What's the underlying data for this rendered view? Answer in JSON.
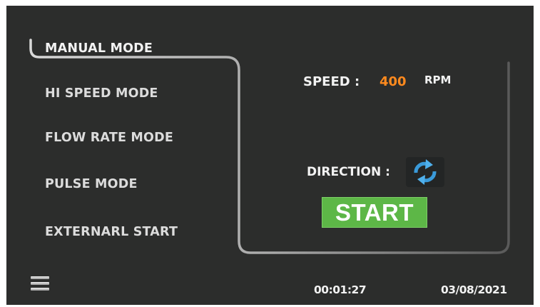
{
  "modes": [
    {
      "label": "MANUAL MODE",
      "active": true
    },
    {
      "label": "HI SPEED MODE",
      "active": false
    },
    {
      "label": "FLOW RATE MODE",
      "active": false
    },
    {
      "label": "PULSE MODE",
      "active": false
    },
    {
      "label": "EXTERNARL START",
      "active": false
    }
  ],
  "panel": {
    "speed_label": "SPEED :",
    "speed_value": "400",
    "speed_unit": "RPM",
    "direction_label": "DIRECTION :",
    "direction_icon": "rotate-arrows-icon",
    "start_label": "START"
  },
  "footer": {
    "menu_icon": "hamburger-menu-icon",
    "time": "00:01:27",
    "date": "03/08/2021"
  },
  "colors": {
    "background": "#2c2d2c",
    "speed_value": "#ff8a1e",
    "start_button": "#5db747",
    "direction_icon": "#3a9ad9"
  }
}
